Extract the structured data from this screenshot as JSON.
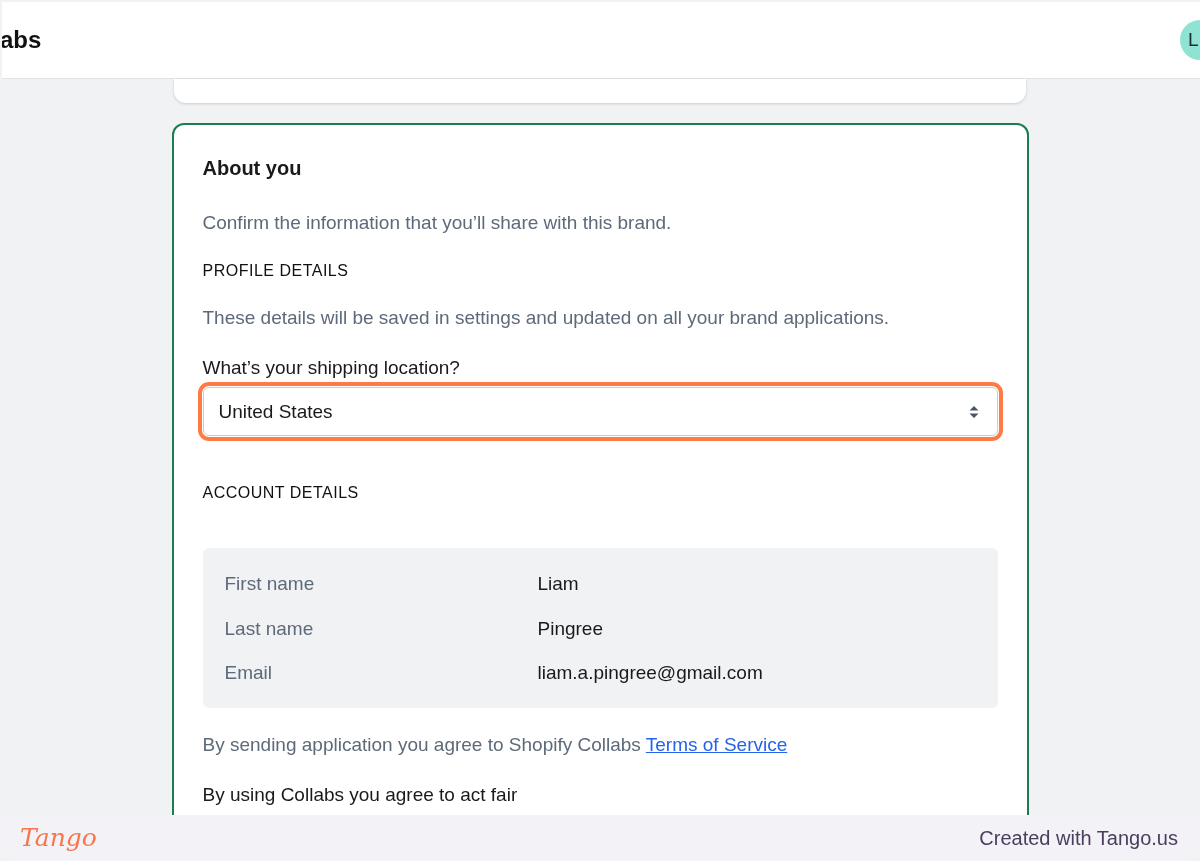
{
  "top_bar": {
    "brand": "abs",
    "avatar_initial": "L"
  },
  "about_card": {
    "title": "About you",
    "intro": "Confirm the information that you’ll share with this brand.",
    "profile_section": {
      "heading": "PROFILE DETAILS",
      "description": "These details will be saved in settings and updated on all your brand applications.",
      "shipping_field": {
        "label": "What’s your shipping location?",
        "value": "United States",
        "highlighted": true
      }
    },
    "account_section": {
      "heading": "ACCOUNT DETAILS",
      "rows": [
        {
          "label": "First name",
          "value": "Liam"
        },
        {
          "label": "Last name",
          "value": "Pingree"
        },
        {
          "label": "Email",
          "value": "liam.a.pingree@gmail.com"
        }
      ]
    },
    "terms": {
      "text": "By sending application you agree to Shopify Collabs",
      "link": "Terms of Service"
    },
    "fair_use_note": "By using Collabs you agree to act fair"
  },
  "footer": {
    "logo": "Tango",
    "credit": "Created with Tango.us"
  }
}
